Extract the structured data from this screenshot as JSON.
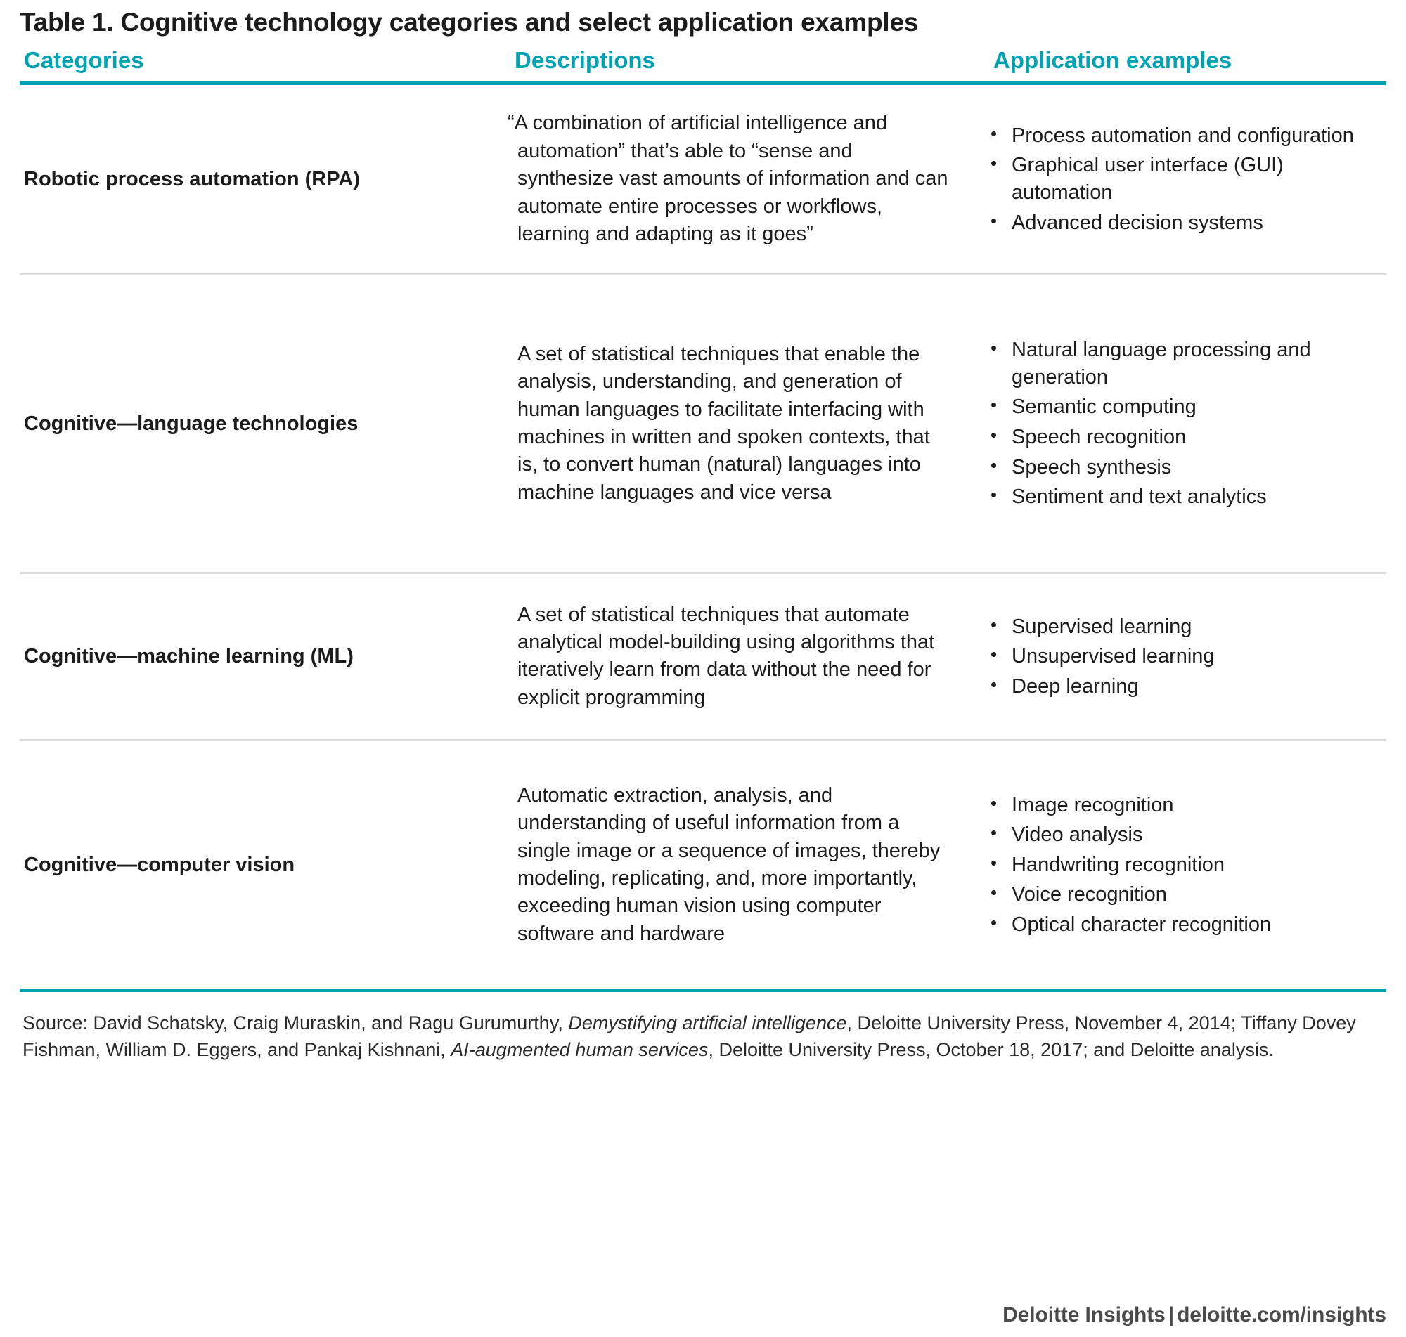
{
  "title": "Table 1. Cognitive technology categories and select application examples",
  "accent_color": "#00A3B4",
  "rule_color": "#dcdcdc",
  "headers": {
    "categories": "Categories",
    "descriptions": "Descriptions",
    "application_examples": "Application examples"
  },
  "rows": [
    {
      "category": "Robotic process automation (RPA)",
      "description": "“A combination of artificial intelligence and automation” that’s able to “sense and synthesize vast amounts of information and can automate entire processes or workflows, learning and adapting as it goes”",
      "examples": [
        "Process automation and configuration",
        "Graphical user interface (GUI) automation",
        "Advanced decision systems"
      ]
    },
    {
      "category": "Cognitive—language technologies",
      "description": "A set of statistical techniques that enable the analysis, understanding, and generation of human languages to facilitate interfacing with machines in written and spoken contexts, that is, to convert human (natural) languages into machine languages and vice versa",
      "examples": [
        "Natural language processing and generation",
        "Semantic computing",
        "Speech recognition",
        "Speech synthesis",
        "Sentiment and text analytics"
      ]
    },
    {
      "category": "Cognitive—machine learning (ML)",
      "description": "A set of statistical techniques that automate analytical model-building using algorithms that iteratively learn from data without the need for explicit programming",
      "examples": [
        "Supervised learning",
        "Unsupervised learning",
        "Deep learning"
      ]
    },
    {
      "category": "Cognitive—computer vision",
      "description": "Automatic extraction, analysis, and understanding of useful information from a single image or a sequence of images, thereby modeling, replicating, and, more importantly, exceeding human vision using computer software and hardware",
      "examples": [
        "Image recognition",
        "Video analysis",
        "Handwriting recognition",
        "Voice recognition",
        "Optical character recognition"
      ]
    }
  ],
  "source": {
    "part1": "Source: David Schatsky, Craig Muraskin, and Ragu Gurumurthy, ",
    "italic1": "Demystifying artificial intelligence",
    "part2": ", Deloitte University Press, November 4, 2014; Tiffany Dovey Fishman, William D. Eggers, and Pankaj Kishnani, ",
    "italic2": "AI-augmented human services",
    "part3": ", Deloitte University Press, October 18, 2017; and Deloitte analysis."
  },
  "footer": {
    "brand": "Deloitte Insights",
    "separator": "|",
    "url": "deloitte.com/insights"
  }
}
